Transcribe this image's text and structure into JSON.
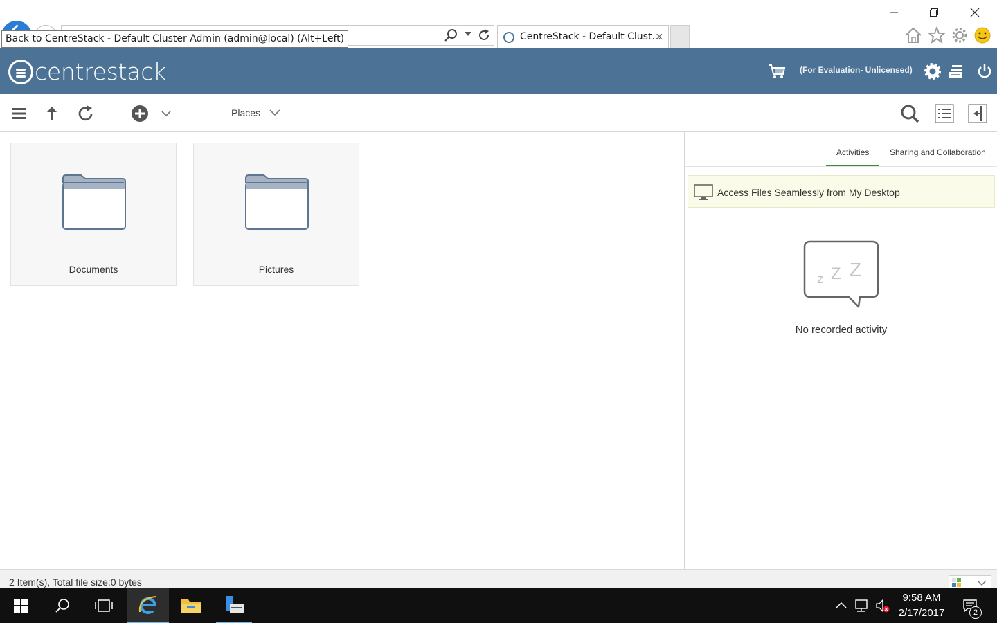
{
  "browser": {
    "tooltip": "Back to CentreStack - Default Cluster Admin (admin@local) (Alt+Left)",
    "tab_title": "CentreStack - Default Clust...",
    "tab_close": "×"
  },
  "header": {
    "logo_text": "centrestack",
    "license_text": "(For Evaluation- Unlicensed)"
  },
  "toolbar": {
    "places_label": "Places"
  },
  "files": {
    "items": [
      {
        "name": "Documents",
        "icon": "folder-icon"
      },
      {
        "name": "Pictures",
        "icon": "folder-icon"
      }
    ]
  },
  "panel": {
    "tabs": [
      "Activities",
      "Sharing and Collaboration"
    ],
    "active_tab": "Activities",
    "desktop_banner": "Access Files Seamlessly from My Desktop",
    "empty_text": "No recorded activity"
  },
  "status": {
    "summary": "2 Item(s), Total file size:0 bytes"
  },
  "taskbar": {
    "time": "9:58 AM",
    "date": "2/17/2017",
    "notifications": "2"
  },
  "colors": {
    "header_bg": "#4c7396",
    "active_tab": "#3c8a3c",
    "banner_bg": "#fbfbea",
    "taskbar_bg": "#101010"
  }
}
